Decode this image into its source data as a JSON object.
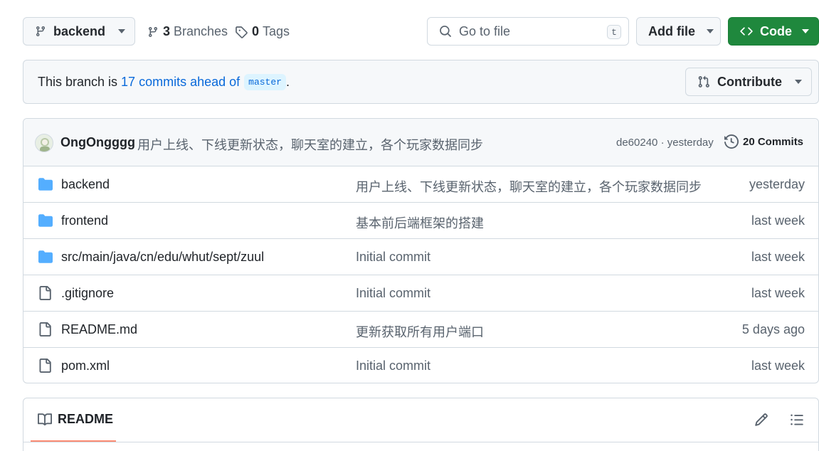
{
  "toolbar": {
    "branch_label": "backend",
    "branches_count": "3",
    "branches_label": "Branches",
    "tags_count": "0",
    "tags_label": "Tags",
    "search_placeholder": "Go to file",
    "search_shortcut": "t",
    "add_file_label": "Add file",
    "code_label": "Code"
  },
  "ahead": {
    "prefix": "This branch is",
    "link_text": "17 commits ahead of",
    "ref": "master",
    "suffix": ".",
    "contribute_label": "Contribute"
  },
  "latest_commit": {
    "author": "OngOngggg",
    "message": "用户上线、下线更新状态，聊天室的建立，各个玩家数据同步",
    "meta": "de60240 · yesterday",
    "commits_label": "20 Commits"
  },
  "files": [
    {
      "type": "folder",
      "name": "backend",
      "message": "用户上线、下线更新状态，聊天室的建立，各个玩家数据同步",
      "time": "yesterday"
    },
    {
      "type": "folder",
      "name": "frontend",
      "message": "基本前后端框架的搭建",
      "time": "last week"
    },
    {
      "type": "folder",
      "name": "src/main/java/cn/edu/whut/sept/zuul",
      "message": "Initial commit",
      "time": "last week"
    },
    {
      "type": "file",
      "name": ".gitignore",
      "message": "Initial commit",
      "time": "last week"
    },
    {
      "type": "file",
      "name": "README.md",
      "message": "更新获取所有用户端口",
      "time": "5 days ago"
    },
    {
      "type": "file",
      "name": "pom.xml",
      "message": "Initial commit",
      "time": "last week"
    }
  ],
  "readme": {
    "tab_label": "README"
  },
  "colors": {
    "accent": "#0969da",
    "code_button": "#1f883d",
    "folder_icon": "#54aeff",
    "tab_underline": "#fd8c73"
  }
}
